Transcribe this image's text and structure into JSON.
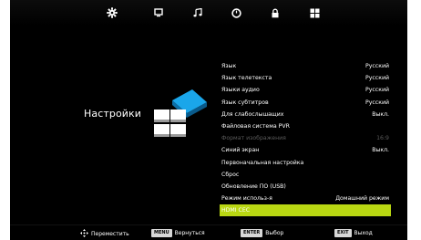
{
  "topbar": {
    "icons": [
      {
        "name": "picture-gear-icon",
        "active": true
      },
      {
        "name": "monitor-icon",
        "active": false
      },
      {
        "name": "music-note-icon",
        "active": false
      },
      {
        "name": "clock-icon",
        "active": false
      },
      {
        "name": "lock-icon",
        "active": false
      },
      {
        "name": "grid-icon",
        "active": false
      }
    ]
  },
  "category": {
    "title": "Настройки",
    "icon": "settings-cube-icon"
  },
  "menu": {
    "items": [
      {
        "label": "Язык",
        "value": "Русский"
      },
      {
        "label": "Язык телетекста",
        "value": "Русский"
      },
      {
        "label": "Языки аудио",
        "value": "Русский"
      },
      {
        "label": "Язык субтитров",
        "value": "Русский"
      },
      {
        "label": "Для слабослышащих",
        "value": "Выкл."
      },
      {
        "label": "Файловая система PVR",
        "value": ""
      },
      {
        "label": "Формат изображения",
        "value": "16:9"
      },
      {
        "label": "Синий экран",
        "value": "Выкл."
      },
      {
        "label": "Первоначальная настройка",
        "value": ""
      },
      {
        "label": "Сброс",
        "value": ""
      },
      {
        "label": "Обновление ПО (USB)",
        "value": ""
      },
      {
        "label": "Режим использ-я",
        "value": "Домашний режим"
      },
      {
        "label": "HDMI CEC",
        "value": ""
      }
    ],
    "disabled_index": 6,
    "selected_index": 12
  },
  "bottombar": {
    "move": {
      "icon": "dpad-icon",
      "label": "Переместить"
    },
    "back": {
      "key": "MENU",
      "label": "Вернуться"
    },
    "select": {
      "key": "ENTER",
      "label": "Выбор"
    },
    "exit": {
      "key": "EXIT",
      "label": "Выход"
    }
  },
  "colors": {
    "selection": "#b9d712",
    "background": "#000000",
    "text": "#ffffff",
    "disabled_text": "#5a5a5a"
  }
}
